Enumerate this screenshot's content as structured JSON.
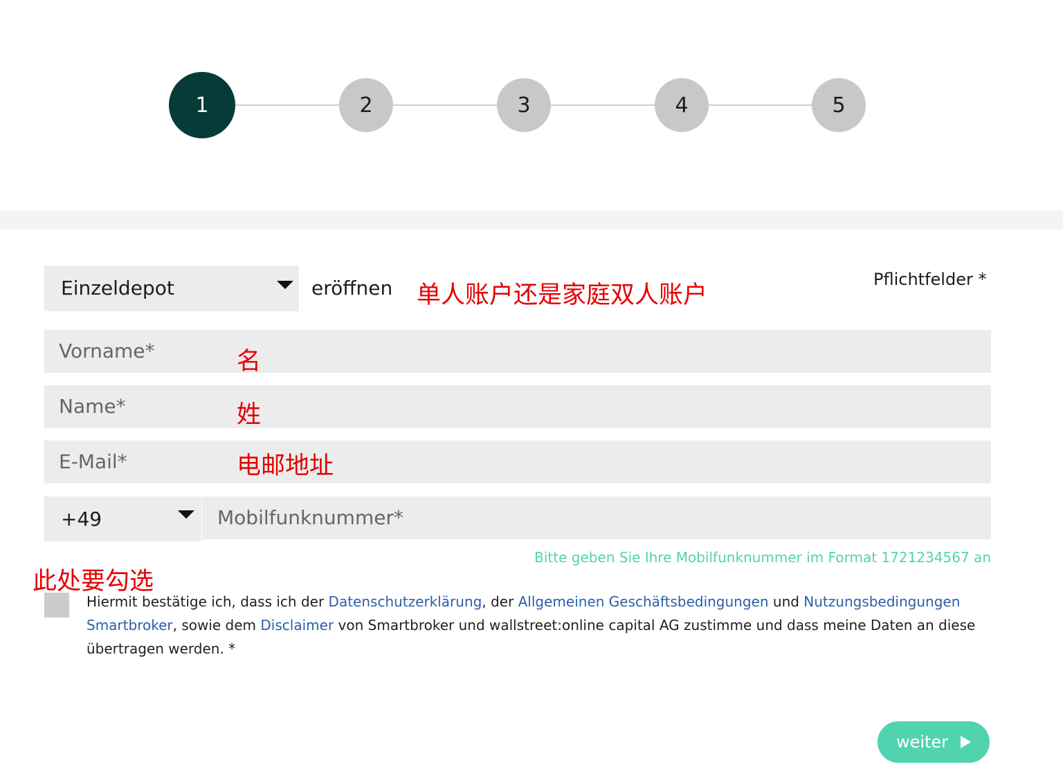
{
  "steps": [
    {
      "label": "1",
      "active": true
    },
    {
      "label": "2",
      "active": false
    },
    {
      "label": "3",
      "active": false
    },
    {
      "label": "4",
      "active": false
    },
    {
      "label": "5",
      "active": false
    }
  ],
  "depot": {
    "selected": "Einzeldepot",
    "suffix": "eröffnen",
    "annotation": "单人账户还是家庭双人账户"
  },
  "required_note": "Pflichtfelder *",
  "fields": {
    "vorname": {
      "placeholder": "Vorname*",
      "annotation": "名"
    },
    "name": {
      "placeholder": "Name*",
      "annotation": "姓"
    },
    "email": {
      "placeholder": "E-Mail*",
      "annotation": "电邮地址"
    }
  },
  "phone": {
    "country_code": "+49",
    "placeholder": "Mobilfunknummer*",
    "hint": "Bitte geben Sie Ihre Mobilfunknummer im Format 1721234567 an"
  },
  "consent": {
    "annotation": "此处要勾选",
    "checked": false,
    "t1": "Hiermit bestätige ich, dass ich der ",
    "l1": "Datenschutzerklärung",
    "t2": ", der ",
    "l2": "Allgemeinen Geschäftsbedingungen",
    "t3": " und ",
    "l3": "Nutzungsbedingungen Smartbroker",
    "t4": ", sowie dem ",
    "l4": "Disclaimer",
    "t5": " von Smartbroker und wallstreet:online capital AG zustimme und dass meine Daten an diese übertragen werden. *"
  },
  "submit": {
    "label": "weiter"
  },
  "colors": {
    "active_step": "#073b3a",
    "inactive_step": "#c8c8c8",
    "accent": "#52d3b0",
    "link": "#2a5fa8",
    "annotation": "#e60000"
  }
}
